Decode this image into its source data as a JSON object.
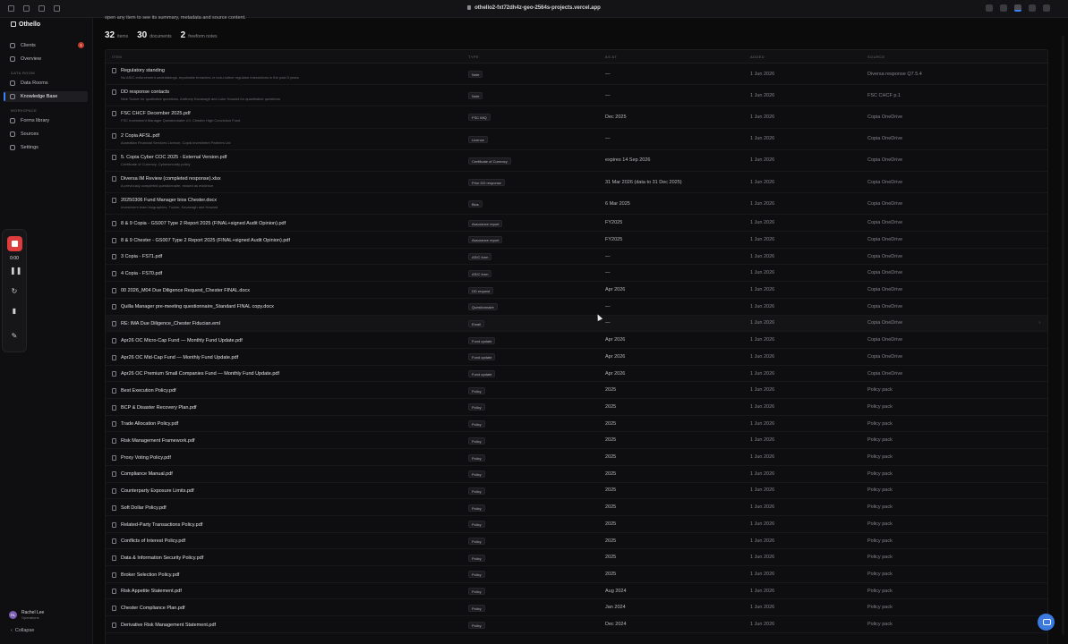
{
  "browser": {
    "url": "othello2-fxt72dh4z-geo-2564s-projects.vercel.app"
  },
  "sidebar": {
    "brand": "Othello",
    "clients_label": "Clients",
    "clients_badge": "1",
    "overview_label": "Overview",
    "data_room_section": "DATA ROOM",
    "data_rooms_label": "Data Rooms",
    "knowledge_base_label": "Knowledge Base",
    "workspace_section": "WORKSPACE",
    "forms_library_label": "Forms library",
    "sources_label": "Sources",
    "settings_label": "Settings",
    "user_initials": "RL",
    "user_name": "Rachel Lee",
    "user_role": "Operations",
    "collapse_label": "Collapse"
  },
  "recorder": {
    "time": "0:00"
  },
  "main": {
    "intro": "open any item to see its summary, metadata and source content.",
    "stats": {
      "items_count": "32",
      "items_label": "items",
      "documents_count": "30",
      "documents_label": "documents",
      "notes_count": "2",
      "notes_label": "freeform notes"
    },
    "columns": {
      "item": "ITEM",
      "type": "TYPE",
      "as_at": "AS AT",
      "added": "ADDED",
      "source": "SOURCE"
    }
  },
  "rows": [
    {
      "name": "Regulatory standing",
      "sub": "No ASIC enforcement undertakings, reportable breaches or non-routine regulator interactions in the past 5 years",
      "type": "Note",
      "as_at": "—",
      "added": "1 Jun 2026",
      "source": "Diversa response Q7.5.4"
    },
    {
      "name": "DD response contacts",
      "sub": "Nick Tucker for qualitative questions, Anthony Kavanagh and Luke Howard for quantitative questions",
      "type": "Note",
      "as_at": "—",
      "added": "1 Jun 2026",
      "source": "FSC CHCF p.1"
    },
    {
      "name": "FSC CHCF December 2025.pdf",
      "sub": "FSC Investment Manager Questionnaire v.0, Chester High Conviction Fund",
      "type": "FSC IMQ",
      "as_at": "Dec 2025",
      "added": "1 Jun 2026",
      "source": "Copia OneDrive"
    },
    {
      "name": "2 Copia AFSL.pdf",
      "sub": "Australian Financial Services Licence, Copia Investment Partners Ltd",
      "type": "Licence",
      "as_at": "—",
      "added": "1 Jun 2026",
      "source": "Copia OneDrive"
    },
    {
      "name": "5. Copia Cyber COC 2025 - External Version.pdf",
      "sub": "Certificate of Currency, Cybersecurity policy",
      "type": "Certificate of Currency",
      "as_at": "expires 14 Sep 2026",
      "added": "1 Jun 2026",
      "source": "Copia OneDrive"
    },
    {
      "name": "Diversa IM Review (completed response).xlsx",
      "sub": "A previously completed questionnaire, reused as evidence",
      "type": "Prior DD response",
      "as_at": "31 Mar 2026 (data to 31 Dec 2025)",
      "added": "1 Jun 2026",
      "source": "Copia OneDrive"
    },
    {
      "name": "20250306 Fund Manager bios Chester.docx",
      "sub": "Investment team biographies, Tucker, Kavanagh and Howard",
      "type": "Bios",
      "as_at": "6 Mar 2025",
      "added": "1 Jun 2026",
      "source": "Copia OneDrive"
    },
    {
      "name": "8 & 9 Copia - GS007 Type 2 Report 2025 (FINAL+signed Audit Opinion).pdf",
      "sub": "",
      "type": "Assurance report",
      "as_at": "FY2025",
      "added": "1 Jun 2026",
      "source": "Copia OneDrive"
    },
    {
      "name": "8 & 9 Chester - GS007 Type 2 Report 2025 (FINAL+signed Audit Opinion).pdf",
      "sub": "",
      "type": "Assurance report",
      "as_at": "FY2025",
      "added": "1 Jun 2026",
      "source": "Copia OneDrive"
    },
    {
      "name": "3 Copia - FS71.pdf",
      "sub": "",
      "type": "ASIC form",
      "as_at": "—",
      "added": "1 Jun 2026",
      "source": "Copia OneDrive"
    },
    {
      "name": "4 Copia - FS70.pdf",
      "sub": "",
      "type": "ASIC form",
      "as_at": "—",
      "added": "1 Jun 2026",
      "source": "Copia OneDrive"
    },
    {
      "name": "00 2026_M04 Due Diligence Request_Chester FINAL.docx",
      "sub": "",
      "type": "DD request",
      "as_at": "Apr 2026",
      "added": "1 Jun 2026",
      "source": "Copia OneDrive"
    },
    {
      "name": "Quilla Manager pre-meeting questionnaire_Standard FINAL copy.docx",
      "sub": "",
      "type": "Questionnaire",
      "as_at": "—",
      "added": "1 Jun 2026",
      "source": "Copia OneDrive"
    },
    {
      "name": "RE: IMA Due Diligence_Chester Fiducian.eml",
      "sub": "",
      "type": "Email",
      "as_at": "—",
      "added": "1 Jun 2026",
      "source": "Copia OneDrive"
    },
    {
      "name": "Apr26 OC Micro-Cap Fund — Monthly Fund Update.pdf",
      "sub": "",
      "type": "Fund update",
      "as_at": "Apr 2026",
      "added": "1 Jun 2026",
      "source": "Copia OneDrive"
    },
    {
      "name": "Apr26 OC Mid-Cap Fund — Monthly Fund Update.pdf",
      "sub": "",
      "type": "Fund update",
      "as_at": "Apr 2026",
      "added": "1 Jun 2026",
      "source": "Copia OneDrive"
    },
    {
      "name": "Apr26 OC Premium Small Companies Fund — Monthly Fund Update.pdf",
      "sub": "",
      "type": "Fund update",
      "as_at": "Apr 2026",
      "added": "1 Jun 2026",
      "source": "Copia OneDrive"
    },
    {
      "name": "Best Execution Policy.pdf",
      "sub": "",
      "type": "Policy",
      "as_at": "2025",
      "added": "1 Jun 2026",
      "source": "Policy pack"
    },
    {
      "name": "BCP & Disaster Recovery Plan.pdf",
      "sub": "",
      "type": "Policy",
      "as_at": "2025",
      "added": "1 Jun 2026",
      "source": "Policy pack"
    },
    {
      "name": "Trade Allocation Policy.pdf",
      "sub": "",
      "type": "Policy",
      "as_at": "2025",
      "added": "1 Jun 2026",
      "source": "Policy pack"
    },
    {
      "name": "Risk Management Framework.pdf",
      "sub": "",
      "type": "Policy",
      "as_at": "2025",
      "added": "1 Jun 2026",
      "source": "Policy pack"
    },
    {
      "name": "Proxy Voting Policy.pdf",
      "sub": "",
      "type": "Policy",
      "as_at": "2025",
      "added": "1 Jun 2026",
      "source": "Policy pack"
    },
    {
      "name": "Compliance Manual.pdf",
      "sub": "",
      "type": "Policy",
      "as_at": "2025",
      "added": "1 Jun 2026",
      "source": "Policy pack"
    },
    {
      "name": "Counterparty Exposure Limits.pdf",
      "sub": "",
      "type": "Policy",
      "as_at": "2025",
      "added": "1 Jun 2026",
      "source": "Policy pack"
    },
    {
      "name": "Soft Dollar Policy.pdf",
      "sub": "",
      "type": "Policy",
      "as_at": "2025",
      "added": "1 Jun 2026",
      "source": "Policy pack"
    },
    {
      "name": "Related-Party Transactions Policy.pdf",
      "sub": "",
      "type": "Policy",
      "as_at": "2025",
      "added": "1 Jun 2026",
      "source": "Policy pack"
    },
    {
      "name": "Conflicts of Interest Policy.pdf",
      "sub": "",
      "type": "Policy",
      "as_at": "2025",
      "added": "1 Jun 2026",
      "source": "Policy pack"
    },
    {
      "name": "Data & Information Security Policy.pdf",
      "sub": "",
      "type": "Policy",
      "as_at": "2025",
      "added": "1 Jun 2026",
      "source": "Policy pack"
    },
    {
      "name": "Broker Selection Policy.pdf",
      "sub": "",
      "type": "Policy",
      "as_at": "2025",
      "added": "1 Jun 2026",
      "source": "Policy pack"
    },
    {
      "name": "Risk Appetite Statement.pdf",
      "sub": "",
      "type": "Policy",
      "as_at": "Aug 2024",
      "added": "1 Jun 2026",
      "source": "Policy pack"
    },
    {
      "name": "Chester Compliance Plan.pdf",
      "sub": "",
      "type": "Policy",
      "as_at": "Jan 2024",
      "added": "1 Jun 2026",
      "source": "Policy pack"
    },
    {
      "name": "Derivative Risk Management Statement.pdf",
      "sub": "",
      "type": "Policy",
      "as_at": "Dec 2024",
      "added": "1 Jun 2026",
      "source": "Policy pack"
    }
  ]
}
